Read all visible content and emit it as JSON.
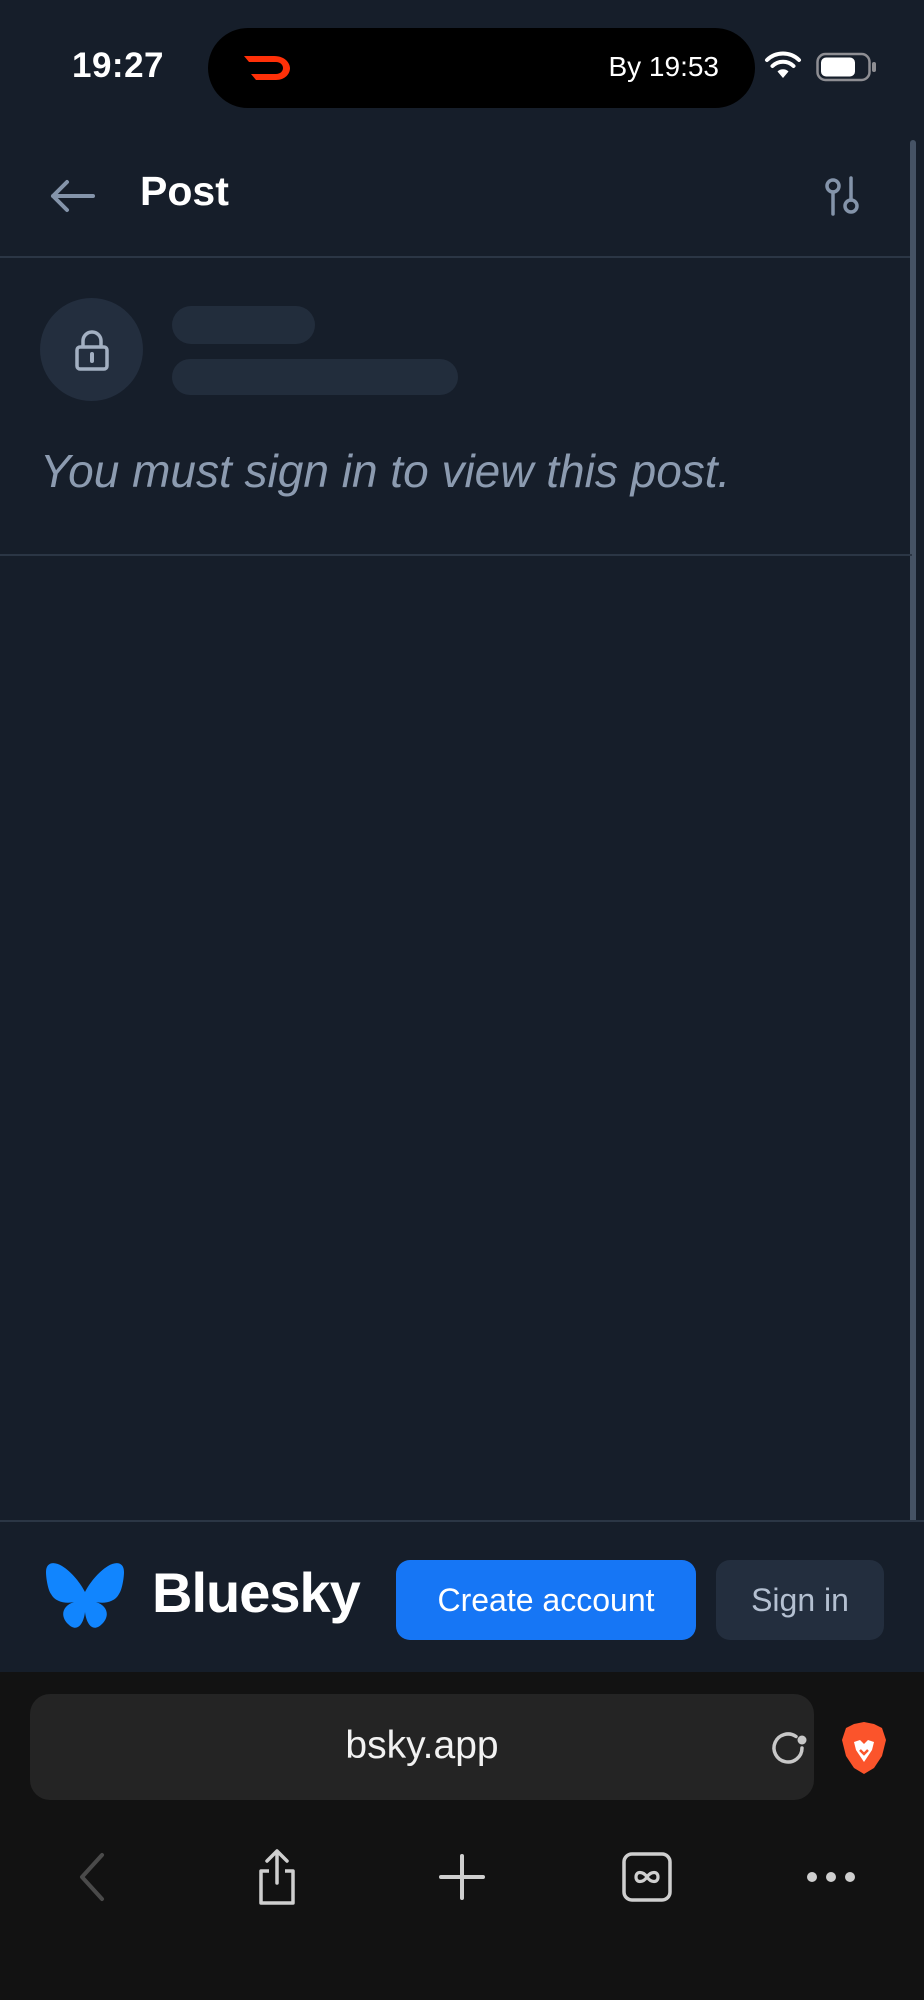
{
  "status_bar": {
    "time": "19:27",
    "live_activity_text": "By 19:53",
    "icons": [
      "doordash-icon",
      "wifi-icon",
      "battery-icon"
    ]
  },
  "header": {
    "title": "Post",
    "icons": [
      "back-arrow-icon",
      "sliders-icon"
    ]
  },
  "post": {
    "message": "You must sign in to view this post.",
    "avatar_icon": "lock-icon"
  },
  "bsky_bar": {
    "brand": "Bluesky",
    "logo_icon": "butterfly-icon",
    "create_account_label": "Create account",
    "sign_in_label": "Sign in"
  },
  "browser": {
    "url": "bsky.app",
    "icons": [
      "reload-icon",
      "brave-lion-icon",
      "back-chevron-icon",
      "share-icon",
      "plus-icon",
      "tabs-icon",
      "more-icon"
    ]
  },
  "colors": {
    "background": "#161e2a",
    "accent": "#1676f5",
    "muted_text": "#8c9bb0",
    "browser_bg": "#121212",
    "brave_orange": "#fb542b",
    "doordash_red": "#ff3008"
  }
}
